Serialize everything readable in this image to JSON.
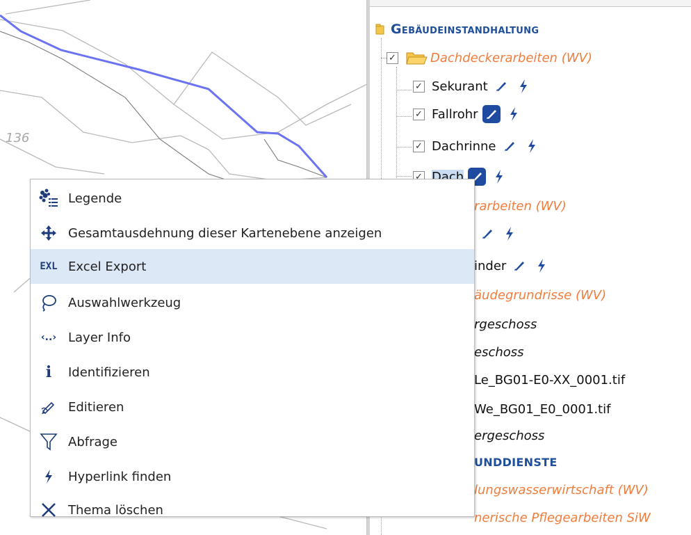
{
  "map": {
    "label": "136"
  },
  "layer_tree": {
    "group": {
      "label": "Gebäudeinstandhaltung"
    },
    "folders": [
      {
        "label": "Dachdeckerarbeiten (WV)",
        "checked": true,
        "items": [
          {
            "label": "Sekurant",
            "checked": true
          },
          {
            "label": "Fallrohr",
            "checked": true,
            "edit_active": true
          },
          {
            "label": "Dachrinne",
            "checked": true
          },
          {
            "label": "Dach",
            "checked": true,
            "edit_active": true,
            "selected": true
          }
        ]
      },
      {
        "label_visible": "rarbeiten (WV)"
      }
    ],
    "partial_rows": [
      {
        "text": "inder"
      },
      {
        "text": "äudegrundrisse (WV)"
      },
      {
        "text": "rgeschoss"
      },
      {
        "text": "eschoss"
      },
      {
        "text": "Le_BG01-E0-XX_0001.tif"
      },
      {
        "text": "We_BG01_E0_0001.tif"
      },
      {
        "text": "ergeschoss"
      },
      {
        "text": "UNDDIENSTE"
      },
      {
        "text": "lungswasserwirtschaft (WV)"
      },
      {
        "text": "nerische Pflegearbeiten SiW"
      }
    ]
  },
  "context_menu": {
    "items": [
      {
        "label": "Legende",
        "icon": "legend-icon"
      },
      {
        "label": "Gesamtausdehnung dieser Kartenebene anzeigen",
        "icon": "move-arrows-icon"
      },
      {
        "label": "Excel Export",
        "icon": "excel-export-icon",
        "icon_text": "EXL",
        "highlighted": true
      },
      {
        "label": "Auswahlwerkzeug",
        "icon": "lasso-icon"
      },
      {
        "label": "Layer Info",
        "icon": "layer-info-icon",
        "icon_text": "‹..›"
      },
      {
        "label": "Identifizieren",
        "icon": "info-icon",
        "icon_text": "i"
      },
      {
        "label": "Editieren",
        "icon": "edit-pencil-icon"
      },
      {
        "label": "Abfrage",
        "icon": "filter-icon"
      },
      {
        "label": "Hyperlink finden",
        "icon": "lightning-icon"
      },
      {
        "label": "Thema löschen",
        "icon": "close-x-icon"
      }
    ]
  },
  "colors": {
    "accent": "#1e4aa0",
    "folder_text": "#f07d3c",
    "route_line": "#6b73f0",
    "menu_highlight": "#dde8f7"
  }
}
